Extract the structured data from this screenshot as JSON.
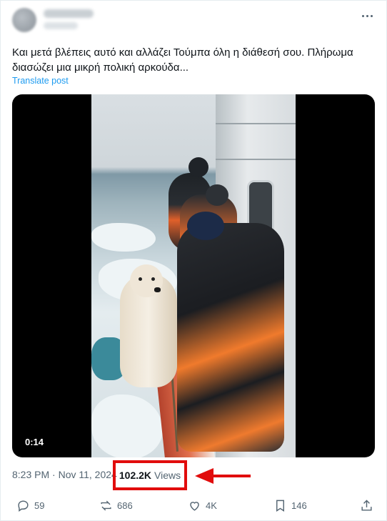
{
  "post": {
    "text": "Και μετά βλέπεις αυτό και αλλάζει Τούμπα όλη η διάθεσή σου. Πλήρωμα\nδιασώζει μια μικρή πολική αρκούδα...",
    "translate_label": "Translate post",
    "video_duration": "0:14",
    "timestamp": "8:23 PM · Nov 11, 2024",
    "views_count": "102.2K",
    "views_label": "Views"
  },
  "actions": {
    "replies": "59",
    "reposts": "686",
    "likes": "4K",
    "bookmarks": "146"
  },
  "colors": {
    "accent": "#1d9bf0",
    "highlight": "#e10c0c",
    "muted": "#536471"
  }
}
